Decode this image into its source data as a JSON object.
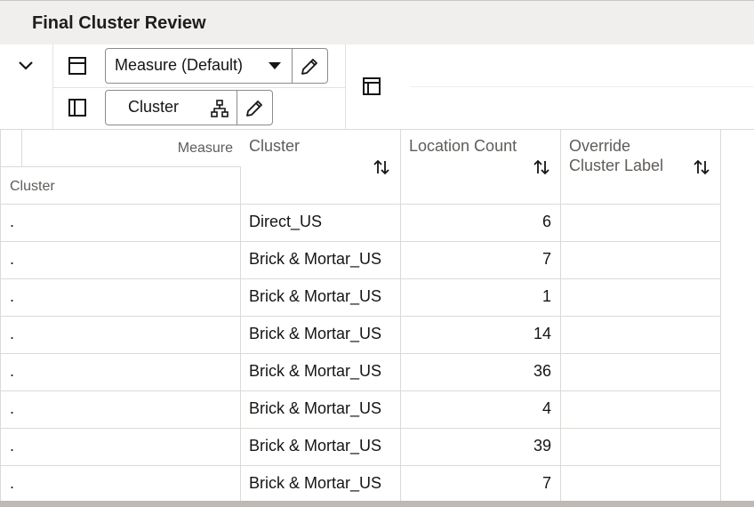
{
  "page": {
    "title": "Final Cluster Review"
  },
  "toolbar": {
    "measure_label": "Measure (Default)",
    "cluster_label": "Cluster"
  },
  "grid": {
    "corner": {
      "measure_label": "Measure",
      "cluster_label": "Cluster"
    },
    "columns": [
      {
        "line1": "Cluster",
        "line2": ""
      },
      {
        "line1": "Location Count",
        "line2": ""
      },
      {
        "line1": "Override",
        "line2": "Cluster Label"
      }
    ],
    "rows": [
      {
        "row_label": ".",
        "cluster": "Direct_US",
        "location_count": "6",
        "override_label": ""
      },
      {
        "row_label": ".",
        "cluster": "Brick & Mortar_US",
        "location_count": "7",
        "override_label": ""
      },
      {
        "row_label": ".",
        "cluster": "Brick & Mortar_US",
        "location_count": "1",
        "override_label": ""
      },
      {
        "row_label": ".",
        "cluster": "Brick & Mortar_US",
        "location_count": "14",
        "override_label": ""
      },
      {
        "row_label": ".",
        "cluster": "Brick & Mortar_US",
        "location_count": "36",
        "override_label": ""
      },
      {
        "row_label": ".",
        "cluster": "Brick & Mortar_US",
        "location_count": "4",
        "override_label": ""
      },
      {
        "row_label": ".",
        "cluster": "Brick & Mortar_US",
        "location_count": "39",
        "override_label": ""
      },
      {
        "row_label": ".",
        "cluster": "Brick & Mortar_US",
        "location_count": "7",
        "override_label": ""
      }
    ]
  },
  "icons": {
    "collapse": "chevron-down-icon",
    "row_layout": "row-layout-icon",
    "column_layout": "column-layout-icon",
    "measure_dropdown": "caret-down-icon",
    "edit": "pencil-icon",
    "hierarchy": "hierarchy-icon",
    "pivot": "pivot-layout-icon",
    "sort": "sort-icon"
  },
  "colors": {
    "header_bg": "#f1efed",
    "border": "#dcdad7",
    "text": "#161513",
    "muted": "#5f5c59"
  }
}
